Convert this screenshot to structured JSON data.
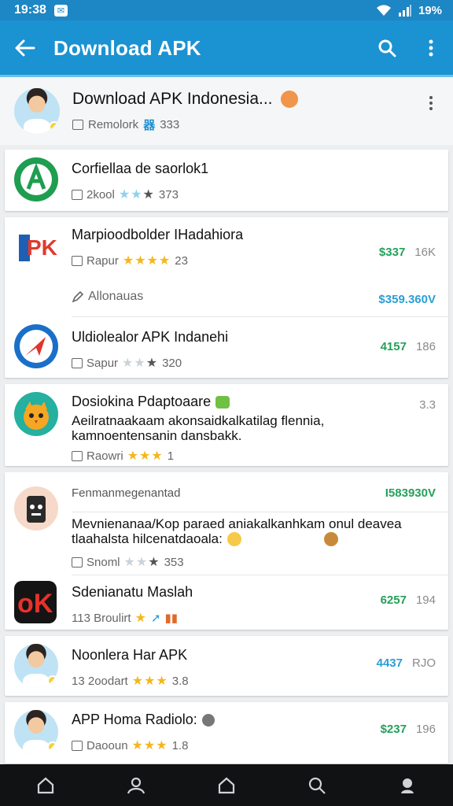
{
  "status_bar": {
    "time": "19:38",
    "battery": "19%"
  },
  "app_bar": {
    "title": "Download APK"
  },
  "header": {
    "title": "Download APK Indonesia...",
    "subtitle": "Remolork",
    "tag": "器",
    "count": "333"
  },
  "apps": [
    {
      "name": "Corfiellaa de saorlok1",
      "meta": "2kool",
      "count": "373"
    },
    {
      "name": "Marpioodbolder IHadahiora",
      "meta": "Rapur",
      "count": "23",
      "price": "$337",
      "size": "16K"
    },
    {
      "name": "Allonauas",
      "price": "$359.360V"
    },
    {
      "name": "Uldiolealor APK Indanehi",
      "meta": "Sapur",
      "count": "320",
      "price": "4157",
      "size": "186"
    },
    {
      "name": "Dosiokina Pdaptoaare",
      "desc": "Aeilratnaakaam akonsaidkalkatilag flennia, kamnoentensanin dansbakk.",
      "meta": "Raowri",
      "count": "1",
      "side": "3.3"
    },
    {
      "name": "Fenmanmegenantad",
      "price": "I583930V"
    },
    {
      "desc1": "Mevnienanaa/Kop paraed aniakalkanhkam onul deavea",
      "desc2": "tlaahalsta hilcenatdaoala:",
      "meta": "Snoml",
      "count": "353"
    },
    {
      "name": "Sdenianatu Maslah",
      "meta": "113 Broulirt",
      "price": "6257",
      "size": "194"
    },
    {
      "name": "Noonlera Har APK",
      "meta": "13 2oodart",
      "count": "3.8",
      "price": "4437",
      "size": "RJO"
    },
    {
      "name": "APP Homa Radiolo:",
      "meta": "Daooun",
      "count": "1.8",
      "price": "$237",
      "size": "196"
    }
  ],
  "colors": {
    "primary": "#1b92d2",
    "price_green": "#24a05a",
    "star": "#f4b71c"
  }
}
